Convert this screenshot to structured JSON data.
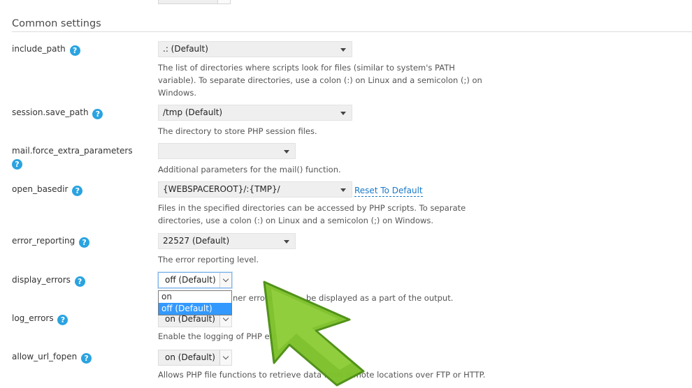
{
  "section_title": "Common settings",
  "settings": [
    {
      "name": "include_path",
      "value": ".: (Default)",
      "desc_lines": [
        "The list of directories where scripts look for files (similar to system's PATH",
        "variable). To separate directories, use a colon (:) on Linux and a semicolon (;) on",
        "Windows."
      ]
    },
    {
      "name": "session.save_path",
      "value": "/tmp (Default)",
      "desc_lines": [
        "The directory to store PHP session files."
      ]
    },
    {
      "name": "mail.force_extra_parameters",
      "value": "",
      "desc_lines": [
        "Additional parameters for the mail() function."
      ]
    },
    {
      "name": "open_basedir",
      "value": "{WEBSPACEROOT}/:{TMP}/",
      "reset_label": "Reset To Default",
      "desc_lines": [
        "Files in the specified directories can be accessed by PHP scripts. To separate",
        "directories, use a colon (:) on Linux and a semicolon (;) on Windows."
      ]
    },
    {
      "name": "error_reporting",
      "value": "22527 (Default)",
      "desc_lines": [
        "The error reporting level."
      ]
    },
    {
      "name": "display_errors",
      "value": "off (Default)",
      "desc_visible": "ner errors",
      "desc_visible_2": "be displayed as a part of the output.",
      "options": [
        "on",
        "off (Default)"
      ],
      "selected_option": "off (Default)"
    },
    {
      "name": "log_errors",
      "value": "on (Default)",
      "desc_lines": [
        "Enable the logging of PHP erro"
      ]
    },
    {
      "name": "allow_url_fopen",
      "value": "on (Default)",
      "desc_lines": [
        "Allows PHP file functions to retrieve data from remote locations over FTP or HTTP."
      ]
    }
  ],
  "help_glyph": "?",
  "colors": {
    "help": "#2aa3e0",
    "link": "#1a7ac8",
    "selected": "#3399ff",
    "arrow_fill": "#7dc12a",
    "arrow_stroke": "#4d8f14"
  }
}
